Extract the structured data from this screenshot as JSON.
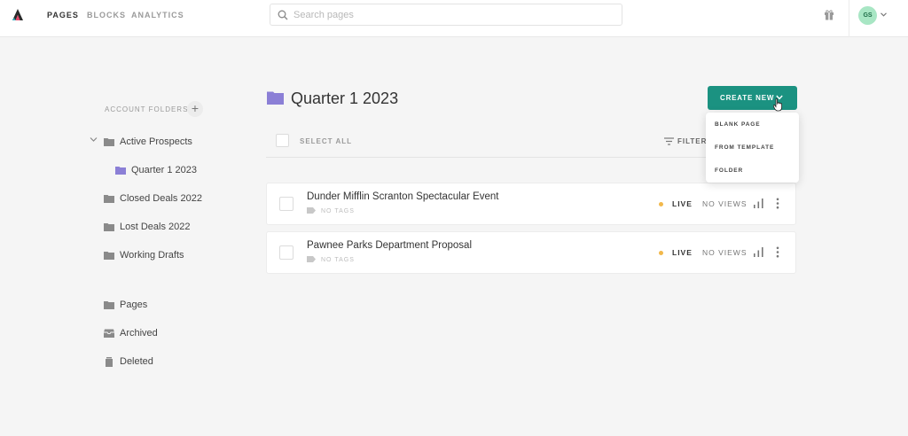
{
  "topbar": {
    "nav": [
      "PAGES",
      "BLOCKS",
      "ANALYTICS"
    ],
    "search_placeholder": "Search pages",
    "avatar_initials": "GS"
  },
  "sidebar": {
    "account_folders_label": "ACCOUNT FOLDERS",
    "add_label": "+",
    "folders": [
      {
        "label": "Active Prospects",
        "icon": "folder-icon",
        "expanded": true
      },
      {
        "label": "Quarter 1 2023",
        "icon": "folder-icon",
        "selected": true
      },
      {
        "label": "Closed Deals 2022",
        "icon": "folder-icon"
      },
      {
        "label": "Lost Deals 2022",
        "icon": "folder-icon"
      },
      {
        "label": "Working Drafts",
        "icon": "folder-icon"
      }
    ],
    "system": [
      {
        "label": "Pages",
        "icon": "folder-icon"
      },
      {
        "label": "Archived",
        "icon": "archive-icon"
      },
      {
        "label": "Deleted",
        "icon": "trash-icon"
      }
    ]
  },
  "main": {
    "title": "Quarter 1 2023",
    "create_new": "CREATE NEW",
    "select_all": "SELECT ALL",
    "filters": "FILTERS",
    "dropdown": [
      "BLANK PAGE",
      "FROM TEMPLATE",
      "FOLDER"
    ],
    "pages": [
      {
        "name": "Dunder Mifflin Scranton Spectacular Event",
        "tags": "NO TAGS",
        "status": "LIVE",
        "views": "NO VIEWS"
      },
      {
        "name": "Pawnee Parks Department Proposal",
        "tags": "NO TAGS",
        "status": "LIVE",
        "views": "NO VIEWS"
      }
    ]
  },
  "colors": {
    "accent": "#1b9281",
    "folder_selected": "#8b7fd6",
    "folder": "#8a8a8a",
    "live_dot": "#f2b84b",
    "avatar_bg": "#a8e6c4"
  }
}
